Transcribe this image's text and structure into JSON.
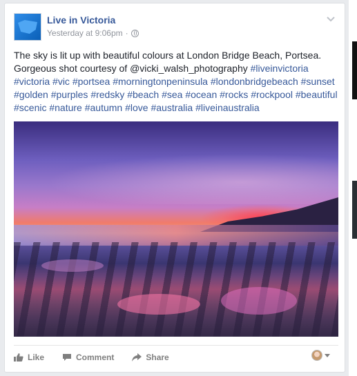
{
  "post": {
    "page_name": "Live in Victoria",
    "timestamp": "Yesterday at 9:06pm",
    "separator": "·",
    "text_lines": [
      "The sky is lit up with beautiful colours at London Bridge Beach, Portsea.",
      "Gorgeous shot courtesy of @vicki_walsh_photography"
    ],
    "hashtags": [
      "#liveinvictoria",
      "#victoria",
      "#vic",
      "#portsea",
      "#morningtonpeninsula",
      "#londonbridgebeach",
      "#sunset",
      "#golden",
      "#purples",
      "#redsky",
      "#beach",
      "#sea",
      "#ocean",
      "#rocks",
      "#rockpool",
      "#beautiful",
      "#scenic",
      "#nature",
      "#autumn",
      "#love",
      "#australia",
      "#liveinaustralia"
    ]
  },
  "actions": {
    "like": "Like",
    "comment": "Comment",
    "share": "Share"
  },
  "icons": {
    "page_avatar": "victoria-map-logo-icon",
    "privacy": "globe-icon",
    "menu": "chevron-down-icon",
    "like": "thumbs-up-icon",
    "comment": "speech-bubble-icon",
    "share": "share-arrow-icon",
    "selector": "user-avatar-icon"
  },
  "colors": {
    "link_blue": "#365899",
    "text": "#1d2129",
    "muted": "#90949c"
  }
}
